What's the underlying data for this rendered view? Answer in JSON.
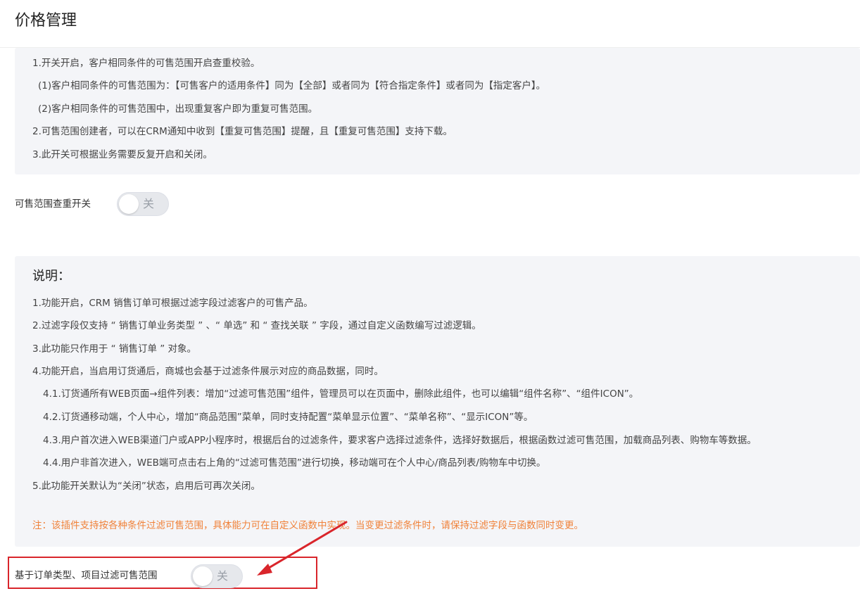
{
  "page": {
    "title": "价格管理"
  },
  "dedupe_section": {
    "lines": [
      "1.开关开启，客户相同条件的可售范围开启查重校验。",
      "(1)客户相同条件的可售范围为：【可售客户的适用条件】同为【全部】或者同为【符合指定条件】或者同为【指定客户】。",
      "(2)客户相同条件的可售范围中，出现重复客户即为重复可售范围。",
      "2.可售范围创建者，可以在CRM通知中收到【重复可售范围】提醒，且【重复可售范围】支持下载。",
      "3.此开关可根据业务需要反复开启和关闭。"
    ],
    "switch_label": "可售范围查重开关",
    "switch_state": "关"
  },
  "filter_section": {
    "heading": "说明：",
    "lines": [
      "1.功能开启，CRM 销售订单可根据过滤字段过滤客户的可售产品。",
      "2.过滤字段仅支持 “ 销售订单业务类型 ” 、“ 单选” 和 “ 查找关联 ” 字段，通过自定义函数编写过滤逻辑。",
      "3.此功能只作用于 “ 销售订单 ” 对象。",
      "4.功能开启，当启用订货通后，商城也会基于过滤条件展示对应的商品数据，同时。",
      "4.1.订货通所有WEB页面→组件列表：增加“过滤可售范围”组件，管理员可以在页面中，删除此组件，也可以编辑“组件名称”、“组件ICON”。",
      "4.2.订货通移动端，个人中心，增加“商品范围”菜单，同时支持配置“菜单显示位置”、“菜单名称”、“显示ICON”等。",
      "4.3.用户首次进入WEB渠道门户或APP小程序时，根据后台的过滤条件，要求客户选择过滤条件，选择好数据后，根据函数过滤可售范围，加载商品列表、购物车等数据。",
      "4.4.用户非首次进入，WEB端可点击右上角的“过滤可售范围”进行切换，移动端可在个人中心/商品列表/购物车中切换。",
      "5.此功能开关默认为“关闭”状态，启用后可再次关闭。"
    ],
    "note": "注：该插件支持按各种条件过滤可售范围，具体能力可在自定义函数中实现。当变更过滤条件时，请保持过滤字段与函数同时变更。",
    "switch_label": "基于订单类型、项目过滤可售范围",
    "switch_state": "关"
  },
  "colors": {
    "note_text": "#f0823a",
    "highlight_border": "#d9252b",
    "box_background": "#f4f5f8"
  }
}
